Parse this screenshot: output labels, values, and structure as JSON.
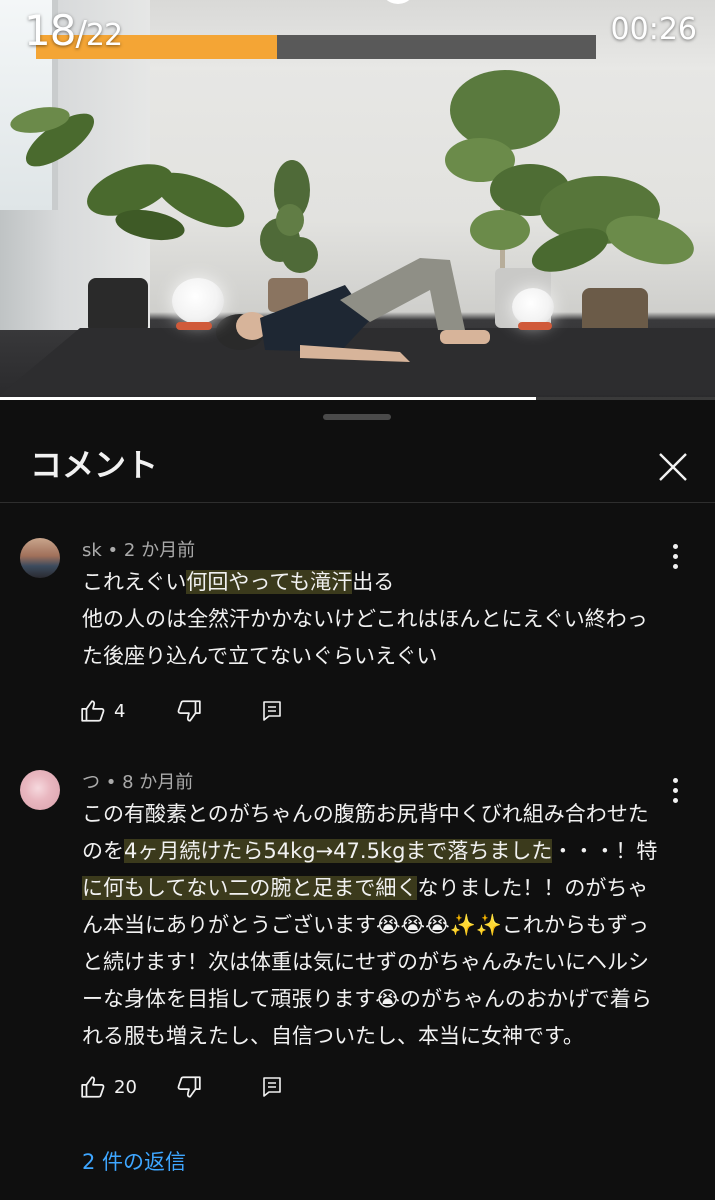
{
  "player": {
    "exercise_current": "18",
    "exercise_separator": "/",
    "exercise_total": "22",
    "timer": "00:26",
    "progress_fraction": 0.43,
    "accent_color": "#f4a535"
  },
  "comments_panel": {
    "title": "コメント",
    "close_icon": "close-icon"
  },
  "comments": [
    {
      "author": "sk",
      "separator": "•",
      "time": "2 か月前",
      "lines": [
        {
          "plain_before": "これえぐい",
          "highlight": "何回やっても滝汗",
          "plain_after": "出る"
        },
        {
          "plain_before": "他の人のは全然汗かかないけどこれはほんとにえぐい終わっ",
          "highlight": "",
          "plain_after": ""
        },
        {
          "plain_before": "た後座り込んで立てないぐらいえぐい",
          "highlight": "",
          "plain_after": ""
        }
      ],
      "likes": "4"
    },
    {
      "author": "つ",
      "separator": "•",
      "time": "8 か月前",
      "lines": [
        {
          "plain_before": "この有酸素とのがちゃんの腹筋お尻背中くびれ組み合わせた",
          "highlight": "",
          "plain_after": ""
        },
        {
          "plain_before": "のを",
          "highlight": "4ヶ月続けたら54kg→47.5kgまで落ちました",
          "plain_after": "・・・！特"
        },
        {
          "plain_before": "",
          "highlight": "に何もしてない二の腕と足まで細く",
          "plain_after": "なりました！！のがちゃ"
        },
        {
          "plain_before": "ん本当にありがとうございます😭😭😭✨✨これからもずっ",
          "highlight": "",
          "plain_after": ""
        },
        {
          "plain_before": "と続けます！次は体重は気にせずのがちゃんみたいにヘルシ",
          "highlight": "",
          "plain_after": ""
        },
        {
          "plain_before": "ーな身体を目指して頑張ります😭のがちゃんのおかげで着ら",
          "highlight": "",
          "plain_after": ""
        },
        {
          "plain_before": "れる服も増えたし、自信ついたし、本当に女神です。",
          "highlight": "",
          "plain_after": ""
        }
      ],
      "likes": "20",
      "replies_label": "2 件の返信"
    }
  ],
  "icons": {
    "like": "thumbs-up-icon",
    "dislike": "thumbs-down-icon",
    "reply": "reply-icon",
    "more": "more-vertical-icon"
  },
  "highlight_color": "#3b3a1c",
  "link_color": "#3ea6ff"
}
